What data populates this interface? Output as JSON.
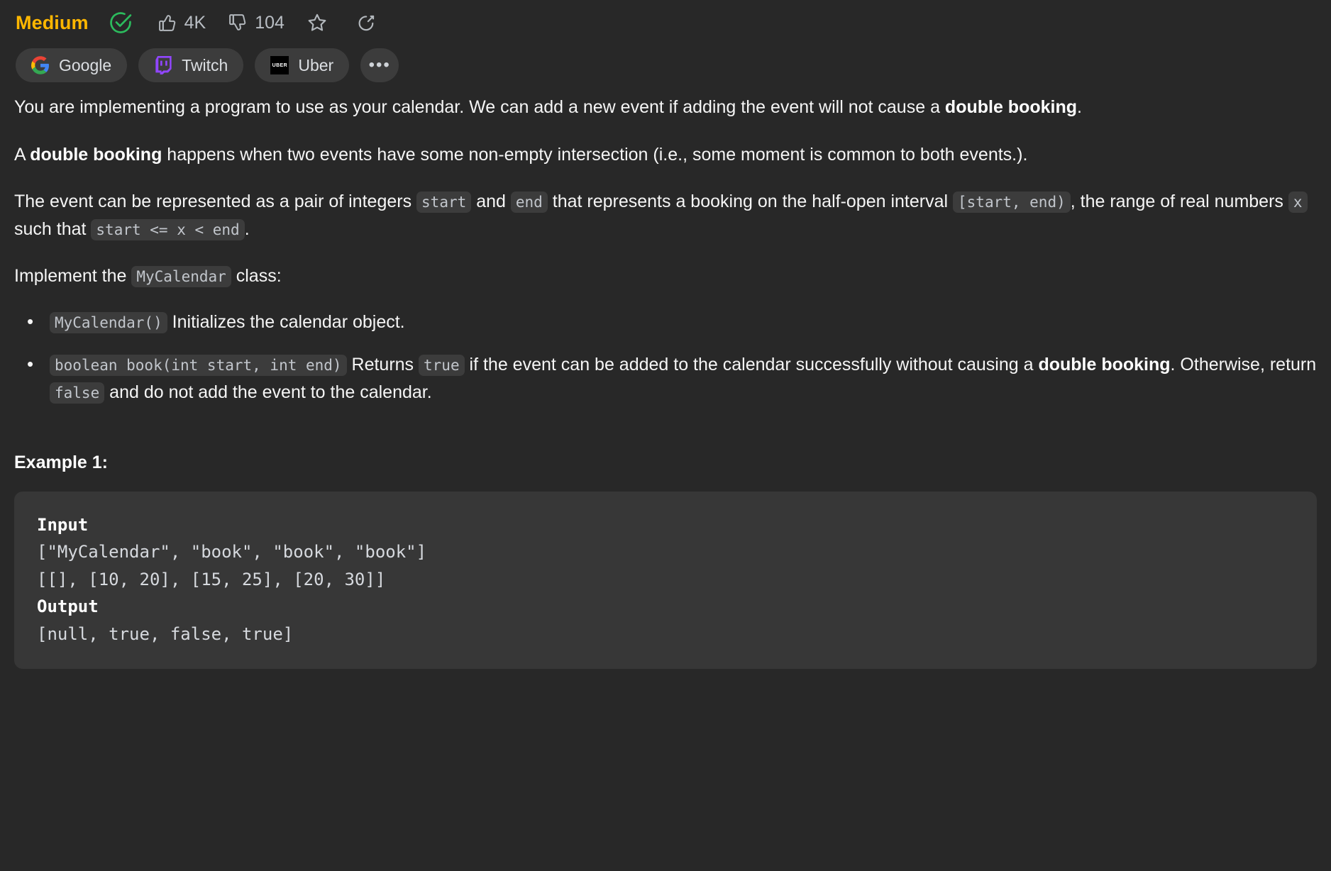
{
  "header": {
    "difficulty": "Medium",
    "solved_icon": "check-circle-icon",
    "like": {
      "icon": "thumbs-up-icon",
      "count": "4K"
    },
    "dislike": {
      "icon": "thumbs-down-icon",
      "count": "104"
    },
    "favorite_icon": "star-icon",
    "share_icon": "share-icon",
    "accent_color": "#ffb700",
    "solved_color": "#2cbb5d"
  },
  "company_tags": [
    {
      "name": "Google",
      "icon": "google-logo-icon"
    },
    {
      "name": "Twitch",
      "icon": "twitch-logo-icon"
    },
    {
      "name": "Uber",
      "icon": "uber-logo-icon",
      "mark": "UBER"
    }
  ],
  "company_more_label": "•••",
  "description": {
    "p1_a": "You are implementing a program to use as your calendar. We can add a new event if adding the event will not cause a ",
    "p1_bold": "double booking",
    "p1_b": ".",
    "p2_a": "A ",
    "p2_bold": "double booking",
    "p2_b": " happens when two events have some non-empty intersection (i.e., some moment is common to both events.).",
    "p3_a": "The event can be represented as a pair of integers ",
    "p3_code1": "start",
    "p3_b": " and ",
    "p3_code2": "end",
    "p3_c": " that represents a booking on the half-open interval ",
    "p3_code3": "[start, end)",
    "p3_d": ", the range of real numbers ",
    "p3_code4": "x",
    "p3_e": " such that ",
    "p3_code5": "start <= x < end",
    "p3_f": ".",
    "p4_a": "Implement the ",
    "p4_code": "MyCalendar",
    "p4_b": " class:"
  },
  "api": {
    "item1": {
      "code": "MyCalendar()",
      "text": " Initializes the calendar object."
    },
    "item2": {
      "code": "boolean book(int start, int end)",
      "text_a": " Returns ",
      "code_true": "true",
      "text_b": " if the event can be added to the calendar successfully without causing a ",
      "bold": "double booking",
      "text_c": ". Otherwise, return ",
      "code_false": "false",
      "text_d": " and do not add the event to the calendar."
    }
  },
  "example": {
    "title": "Example 1:",
    "input_label": "Input",
    "input_line1": "[\"MyCalendar\", \"book\", \"book\", \"book\"]",
    "input_line2": "[[], [10, 20], [15, 25], [20, 30]]",
    "output_label": "Output",
    "output_line1": "[null, true, false, true]"
  }
}
